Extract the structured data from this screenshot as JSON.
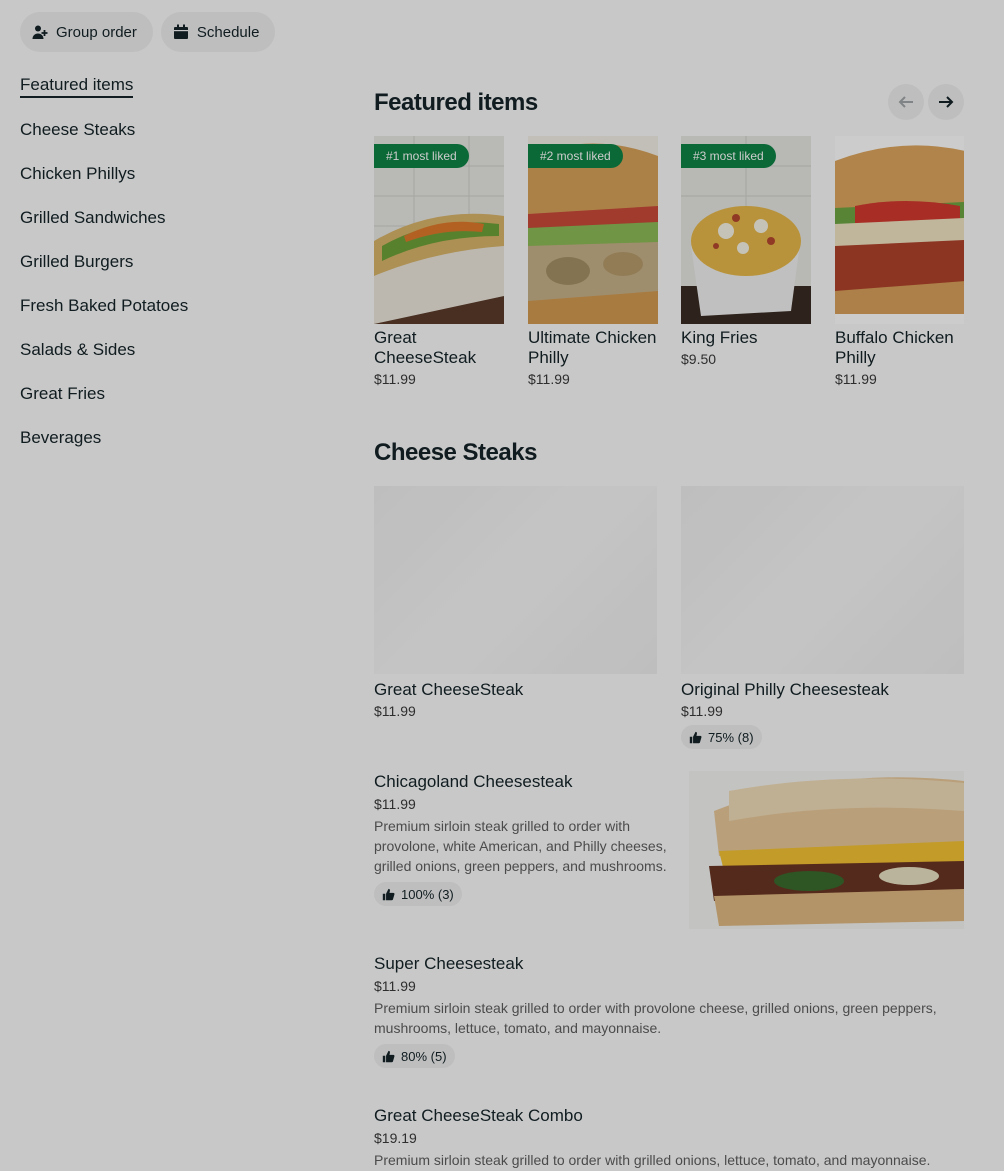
{
  "top_actions": {
    "group_order": "Group order",
    "schedule": "Schedule"
  },
  "sidebar": {
    "items": [
      {
        "label": "Featured items"
      },
      {
        "label": "Cheese Steaks"
      },
      {
        "label": "Chicken Phillys"
      },
      {
        "label": "Grilled Sandwiches"
      },
      {
        "label": "Grilled Burgers"
      },
      {
        "label": "Fresh Baked Potatoes"
      },
      {
        "label": "Salads & Sides"
      },
      {
        "label": "Great Fries"
      },
      {
        "label": "Beverages"
      }
    ]
  },
  "featured": {
    "title": "Featured items",
    "items": [
      {
        "badge": "#1 most liked",
        "name": "Great CheeseSteak",
        "price": "$11.99"
      },
      {
        "badge": "#2 most liked",
        "name": "Ultimate Chicken Philly",
        "price": "$11.99"
      },
      {
        "badge": "#3 most liked",
        "name": "King Fries",
        "price": "$9.50"
      },
      {
        "name": "Buffalo Chicken Philly",
        "price": "$11.99"
      }
    ]
  },
  "cheese_steaks": {
    "title": "Cheese Steaks",
    "grid": [
      {
        "name": "Great CheeseSteak",
        "price": "$11.99"
      },
      {
        "name": "Original Philly Cheesesteak",
        "price": "$11.99",
        "rating": "75% (8)"
      }
    ],
    "list": [
      {
        "name": "Chicagoland Cheesesteak",
        "price": "$11.99",
        "description": "Premium sirloin steak grilled to order with provolone, white American, and Philly cheeses, grilled onions, green peppers, and mushrooms.",
        "rating": "100% (3)"
      },
      {
        "name": "Super Cheesesteak",
        "price": "$11.99",
        "description": "Premium sirloin steak grilled to order with provolone cheese, grilled onions, green peppers, mushrooms, lettuce, tomato, and mayonnaise.",
        "rating": "80% (5)"
      },
      {
        "name": "Great CheeseSteak Combo",
        "price": "$19.19",
        "description": "Premium sirloin steak grilled to order with grilled onions, lettuce, tomato, and mayonnaise."
      }
    ]
  },
  "colors": {
    "badge_green": "#0e8345",
    "text": "#142328",
    "pill_bg": "#eeeeee"
  }
}
